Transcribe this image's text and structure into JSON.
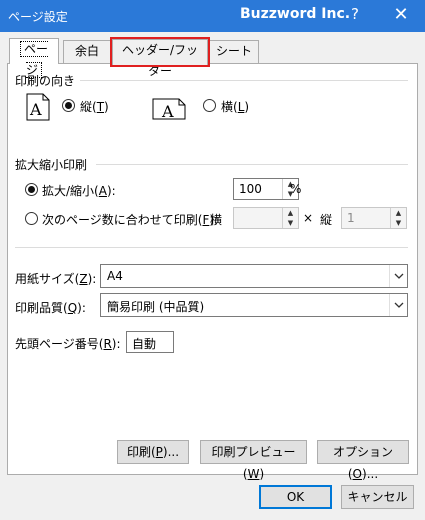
{
  "window": {
    "title": "ページ設定",
    "brand": "Buzzword Inc.",
    "help": "?",
    "close": "✕"
  },
  "tabs": [
    {
      "label": "ページ",
      "active": true
    },
    {
      "label": "余白"
    },
    {
      "label": "ヘッダー/フッター",
      "highlighted": true
    },
    {
      "label": "シート"
    }
  ],
  "orientation": {
    "title": "印刷の向き",
    "portrait": {
      "label": "縦",
      "key": "T",
      "checked": true
    },
    "landscape": {
      "label": "横",
      "key": "L",
      "checked": false
    },
    "icon_letter": "A"
  },
  "scaling": {
    "title": "拡大縮小印刷",
    "zoom": {
      "label": "拡大/縮小",
      "key": "A",
      "checked": true,
      "value": "100",
      "unit": "%"
    },
    "fit": {
      "label": "次のページ数に合わせて印刷",
      "key": "F",
      "checked": false,
      "wide_label": "横",
      "times": "×",
      "tall_label": "縦",
      "tall_value": "1",
      "wide_value": ""
    }
  },
  "paper": {
    "size_label": "用紙サイズ",
    "size_key": "Z",
    "size_value": "A4",
    "quality_label": "印刷品質",
    "quality_key": "Q",
    "quality_value": "簡易印刷 (中品質)",
    "first_page_label": "先頭ページ番号",
    "first_page_key": "R",
    "first_page_value": "自動"
  },
  "actions": {
    "print": "印刷",
    "print_key": "P",
    "preview": "印刷プレビュー",
    "preview_key": "W",
    "options": "オプション",
    "options_key": "O",
    "ellipsis": "..."
  },
  "footer": {
    "ok": "OK",
    "cancel": "キャンセル"
  },
  "colors": {
    "titlebar": "#2b79d8",
    "highlight": "#e02020",
    "default_button": "#0078d7"
  }
}
